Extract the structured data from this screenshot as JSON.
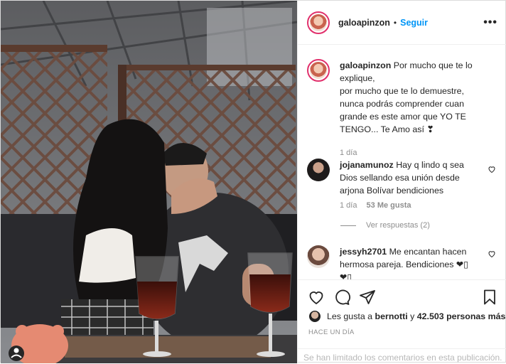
{
  "header": {
    "username": "galoapinzon",
    "separator": "•",
    "follow_label": "Seguir",
    "more_label": "•••"
  },
  "caption": {
    "username": "galoapinzon",
    "text": "Por mucho que te lo explique, por mucho que te lo demuestre, nunca podrás comprender cuan grande es este amor que YO TE TENGO... Te Amo así ❣",
    "lines": [
      "Por mucho que te lo",
      "explique,",
      "por mucho que te lo demuestre,",
      "nunca podrás comprender cuan",
      "grande es este amor que YO TE",
      "TENGO... Te Amo así ❣"
    ],
    "time": "1 día"
  },
  "comments": [
    {
      "username": "jojanamunoz",
      "text_lines": [
        "Hay q lindo q sea",
        "Dios sellando esa unión desde",
        "arjona Bolívar bendiciones"
      ],
      "time": "1 día",
      "likes": "53 Me gusta",
      "replies_label": "Ver respuestas (2)"
    },
    {
      "username": "jessyh2701",
      "text_lines": [
        "Me encantan hacen",
        "hermosa pareja. Bendiciones ❤▯",
        "❤▯"
      ]
    }
  ],
  "likes": {
    "prefix": "Les gusta a",
    "user": "bernotti",
    "conj": "y",
    "count": "42.503 personas más"
  },
  "time_ago": "HACE UN DÍA",
  "comments_limited": "Se han limitado los comentarios en esta publicación.",
  "icons": [
    "heart-icon",
    "comment-icon",
    "share-icon",
    "bookmark-icon",
    "more-icon"
  ],
  "colors": {
    "accent": "#0095f6",
    "text": "#262626",
    "muted": "#8e8e8e",
    "border": "#dbdbdb",
    "story_ring": "#e1306c"
  }
}
